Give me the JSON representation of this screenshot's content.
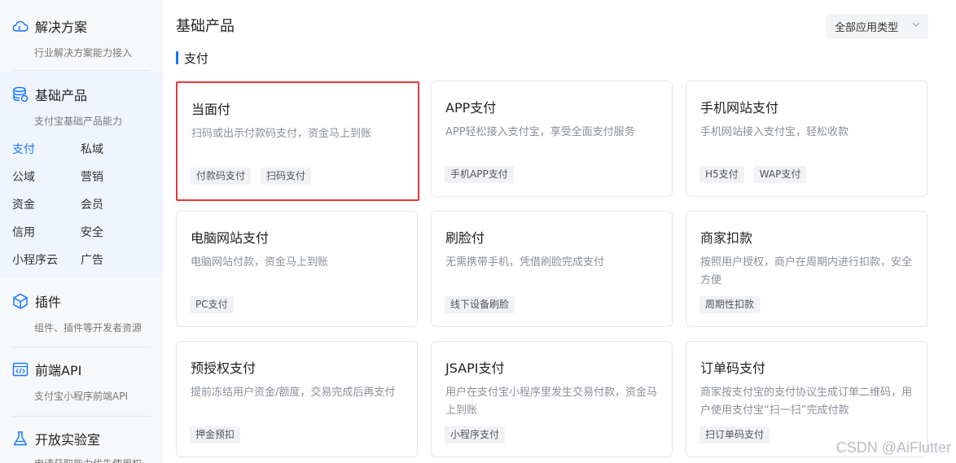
{
  "sidebar": {
    "sections": [
      {
        "title": "解决方案",
        "subtitle": "行业解决方案能力接入",
        "icon": "cloud-icon"
      },
      {
        "title": "基础产品",
        "subtitle": "支付宝基础产品能力",
        "icon": "database-icon"
      },
      {
        "title": "插件",
        "subtitle": "组件、插件等开发者资源",
        "icon": "cube-icon"
      },
      {
        "title": "前端API",
        "subtitle": "支付宝小程序前端API",
        "icon": "code-window-icon"
      },
      {
        "title": "开放实验室",
        "subtitle": "申请获取能力优先使用权",
        "icon": "flask-icon"
      }
    ],
    "product_links": [
      "支付",
      "私域",
      "公域",
      "营销",
      "资金",
      "会员",
      "信用",
      "安全",
      "小程序云",
      "广告"
    ]
  },
  "main": {
    "page_title": "基础产品",
    "filter_label": "全部应用类型",
    "section_label": "支付",
    "cards": [
      {
        "title": "当面付",
        "desc": "扫码或出示付款码支付，资金马上到账",
        "tags": [
          "付款码支付",
          "扫码支付"
        ]
      },
      {
        "title": "APP支付",
        "desc": "APP轻松接入支付宝，享受全面支付服务",
        "tags": [
          "手机APP支付"
        ]
      },
      {
        "title": "手机网站支付",
        "desc": "手机网站接入支付宝，轻松收款",
        "tags": [
          "H5支付",
          "WAP支付"
        ]
      },
      {
        "title": "电脑网站支付",
        "desc": "电脑网站付款，资金马上到账",
        "tags": [
          "PC支付"
        ]
      },
      {
        "title": "刷脸付",
        "desc": "无需携带手机，凭借刷脸完成支付",
        "tags": [
          "线下设备刷脸"
        ]
      },
      {
        "title": "商家扣款",
        "desc": "按照用户授权，商户在周期内进行扣款，安全方便",
        "tags": [
          "周期性扣款"
        ]
      },
      {
        "title": "预授权支付",
        "desc": "提前冻结用户资金/额度，交易完成后再支付",
        "tags": [
          "押金预扣"
        ]
      },
      {
        "title": "JSAPI支付",
        "desc": "用户在支付宝小程序里发生交易付款，资金马上到账",
        "tags": [
          "小程序支付"
        ]
      },
      {
        "title": "订单码支付",
        "desc": "商家按支付宝的支付协议生成订单二维码，用户使用支付宝“扫一扫”完成付款",
        "tags": [
          "扫订单码支付"
        ]
      }
    ]
  },
  "watermark": "CSDN @AiFlutter",
  "colors": {
    "accent": "#1677ff",
    "highlight": "#e4393c"
  }
}
